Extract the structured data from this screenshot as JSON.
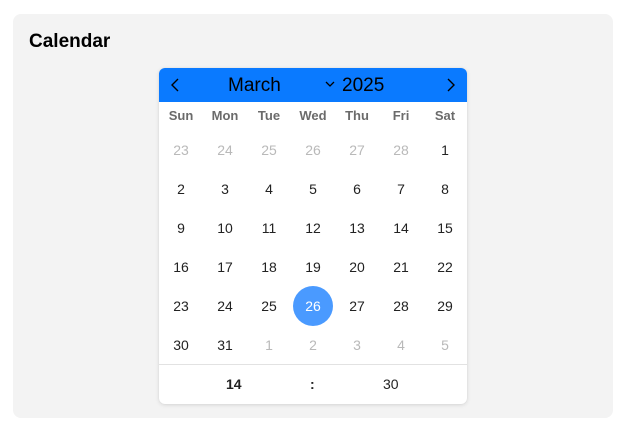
{
  "panel": {
    "title": "Calendar"
  },
  "calendar": {
    "month": "March",
    "year": "2025",
    "weekdays": [
      "Sun",
      "Mon",
      "Tue",
      "Wed",
      "Thu",
      "Fri",
      "Sat"
    ],
    "weeks": [
      [
        {
          "d": "23",
          "muted": true
        },
        {
          "d": "24",
          "muted": true
        },
        {
          "d": "25",
          "muted": true
        },
        {
          "d": "26",
          "muted": true
        },
        {
          "d": "27",
          "muted": true
        },
        {
          "d": "28",
          "muted": true
        },
        {
          "d": "1",
          "muted": false
        }
      ],
      [
        {
          "d": "2",
          "muted": false
        },
        {
          "d": "3",
          "muted": false
        },
        {
          "d": "4",
          "muted": false
        },
        {
          "d": "5",
          "muted": false
        },
        {
          "d": "6",
          "muted": false
        },
        {
          "d": "7",
          "muted": false
        },
        {
          "d": "8",
          "muted": false
        }
      ],
      [
        {
          "d": "9",
          "muted": false
        },
        {
          "d": "10",
          "muted": false
        },
        {
          "d": "11",
          "muted": false
        },
        {
          "d": "12",
          "muted": false
        },
        {
          "d": "13",
          "muted": false
        },
        {
          "d": "14",
          "muted": false
        },
        {
          "d": "15",
          "muted": false
        }
      ],
      [
        {
          "d": "16",
          "muted": false
        },
        {
          "d": "17",
          "muted": false
        },
        {
          "d": "18",
          "muted": false
        },
        {
          "d": "19",
          "muted": false
        },
        {
          "d": "20",
          "muted": false
        },
        {
          "d": "21",
          "muted": false
        },
        {
          "d": "22",
          "muted": false
        }
      ],
      [
        {
          "d": "23",
          "muted": false
        },
        {
          "d": "24",
          "muted": false
        },
        {
          "d": "25",
          "muted": false
        },
        {
          "d": "26",
          "muted": false,
          "selected": true
        },
        {
          "d": "27",
          "muted": false
        },
        {
          "d": "28",
          "muted": false
        },
        {
          "d": "29",
          "muted": false
        }
      ],
      [
        {
          "d": "30",
          "muted": false
        },
        {
          "d": "31",
          "muted": false
        },
        {
          "d": "1",
          "muted": true
        },
        {
          "d": "2",
          "muted": true
        },
        {
          "d": "3",
          "muted": true
        },
        {
          "d": "4",
          "muted": true
        },
        {
          "d": "5",
          "muted": true
        }
      ]
    ],
    "time": {
      "hour": "14",
      "separator": ":",
      "minute": "30"
    },
    "icons": {
      "prev": "chevron-left-icon",
      "next": "chevron-right-icon",
      "month_dropdown": "chevron-down-icon"
    },
    "colors": {
      "header_bg": "#0a7aff",
      "selected_bg": "#4a9aff",
      "muted_text": "#b9b9b9"
    }
  }
}
